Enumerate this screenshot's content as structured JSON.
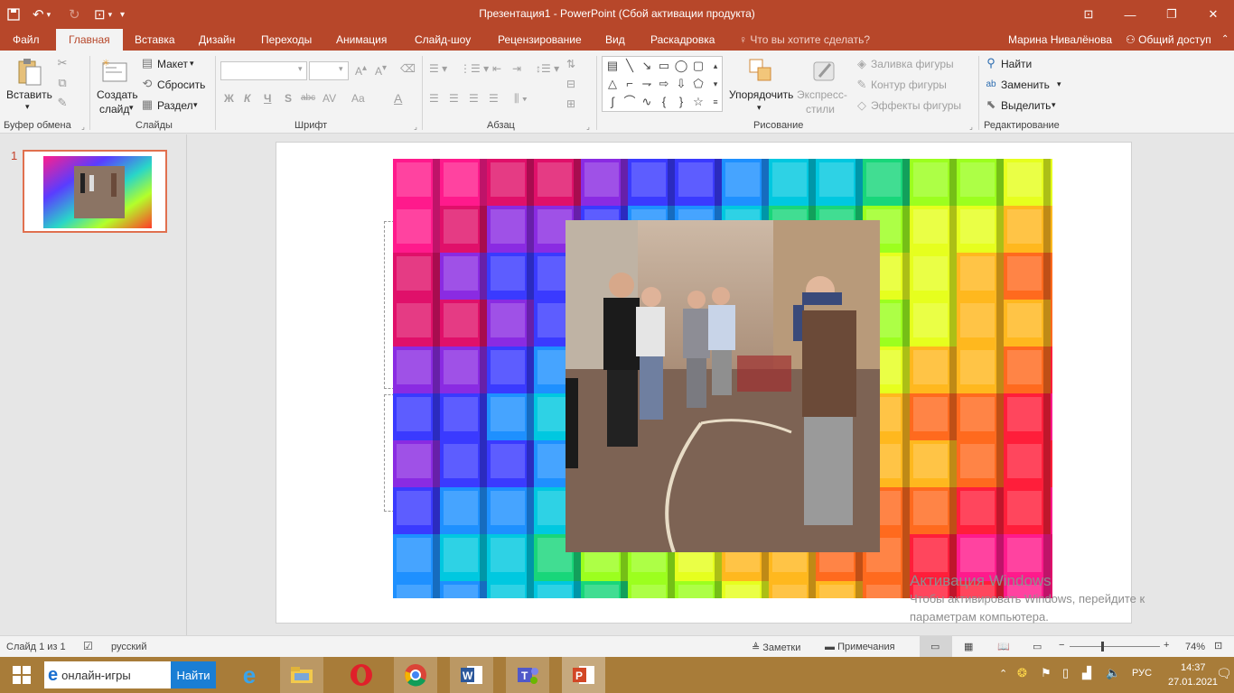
{
  "titlebar": {
    "title": "Презентация1 - PowerPoint (Сбой активации продукта)"
  },
  "tabs": [
    "Файл",
    "Главная",
    "Вставка",
    "Дизайн",
    "Переходы",
    "Анимация",
    "Слайд-шоу",
    "Рецензирование",
    "Вид",
    "Раскадровка"
  ],
  "tellme": "Что вы хотите сделать?",
  "user_name": "Марина Нивалёнова",
  "share_label": "Общий доступ",
  "ribbon": {
    "clipboard": {
      "paste": "Вставить",
      "label": "Буфер обмена"
    },
    "slides": {
      "new1": "Создать",
      "new2": "слайд",
      "layout": "Макет",
      "reset": "Сбросить",
      "section": "Раздел",
      "label": "Слайды"
    },
    "font": {
      "label": "Шрифт",
      "bold": "Ж",
      "italic": "К",
      "underline": "Ч",
      "shadow": "S",
      "strike": "abc",
      "spacing": "AV",
      "case": "Aa"
    },
    "paragraph": {
      "label": "Абзац"
    },
    "drawing": {
      "arrange": "Упорядочить",
      "styles1": "Экспресс-",
      "styles2": "стили",
      "fill": "Заливка фигуры",
      "outline": "Контур фигуры",
      "effects": "Эффекты фигуры",
      "label": "Рисование"
    },
    "editing": {
      "find": "Найти",
      "replace": "Заменить",
      "select": "Выделить",
      "label": "Редактирование"
    }
  },
  "thumbnail": {
    "number": "1"
  },
  "watermark": {
    "line1": "Активация Windows",
    "line2": "Чтобы активировать Windows, перейдите к",
    "line3": "параметрам компьютера."
  },
  "statusbar": {
    "slide_info": "Слайд 1 из 1",
    "language": "русский",
    "notes": "Заметки",
    "comments": "Примечания",
    "zoom": "74%"
  },
  "taskbar": {
    "search_text": "онлайн-игры",
    "search_button": "Найти",
    "lang": "РУС",
    "time": "14:37",
    "date": "27.01.2021"
  },
  "colors": {
    "accent": "#b7472a",
    "taskbar": "#a87c39"
  }
}
